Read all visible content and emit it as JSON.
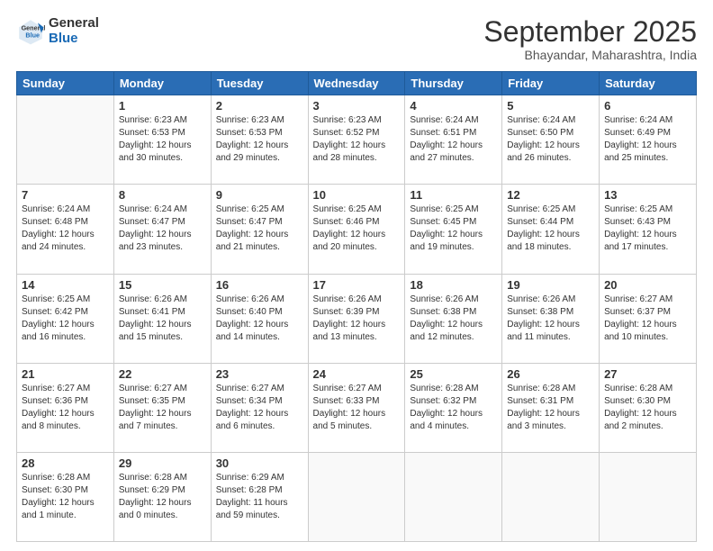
{
  "header": {
    "logo": {
      "general": "General",
      "blue": "Blue"
    },
    "title": "September 2025",
    "subtitle": "Bhayandar, Maharashtra, India"
  },
  "weekdays": [
    "Sunday",
    "Monday",
    "Tuesday",
    "Wednesday",
    "Thursday",
    "Friday",
    "Saturday"
  ],
  "weeks": [
    [
      {
        "day": "",
        "info": ""
      },
      {
        "day": "1",
        "info": "Sunrise: 6:23 AM\nSunset: 6:53 PM\nDaylight: 12 hours\nand 30 minutes."
      },
      {
        "day": "2",
        "info": "Sunrise: 6:23 AM\nSunset: 6:53 PM\nDaylight: 12 hours\nand 29 minutes."
      },
      {
        "day": "3",
        "info": "Sunrise: 6:23 AM\nSunset: 6:52 PM\nDaylight: 12 hours\nand 28 minutes."
      },
      {
        "day": "4",
        "info": "Sunrise: 6:24 AM\nSunset: 6:51 PM\nDaylight: 12 hours\nand 27 minutes."
      },
      {
        "day": "5",
        "info": "Sunrise: 6:24 AM\nSunset: 6:50 PM\nDaylight: 12 hours\nand 26 minutes."
      },
      {
        "day": "6",
        "info": "Sunrise: 6:24 AM\nSunset: 6:49 PM\nDaylight: 12 hours\nand 25 minutes."
      }
    ],
    [
      {
        "day": "7",
        "info": "Sunrise: 6:24 AM\nSunset: 6:48 PM\nDaylight: 12 hours\nand 24 minutes."
      },
      {
        "day": "8",
        "info": "Sunrise: 6:24 AM\nSunset: 6:47 PM\nDaylight: 12 hours\nand 23 minutes."
      },
      {
        "day": "9",
        "info": "Sunrise: 6:25 AM\nSunset: 6:47 PM\nDaylight: 12 hours\nand 21 minutes."
      },
      {
        "day": "10",
        "info": "Sunrise: 6:25 AM\nSunset: 6:46 PM\nDaylight: 12 hours\nand 20 minutes."
      },
      {
        "day": "11",
        "info": "Sunrise: 6:25 AM\nSunset: 6:45 PM\nDaylight: 12 hours\nand 19 minutes."
      },
      {
        "day": "12",
        "info": "Sunrise: 6:25 AM\nSunset: 6:44 PM\nDaylight: 12 hours\nand 18 minutes."
      },
      {
        "day": "13",
        "info": "Sunrise: 6:25 AM\nSunset: 6:43 PM\nDaylight: 12 hours\nand 17 minutes."
      }
    ],
    [
      {
        "day": "14",
        "info": "Sunrise: 6:25 AM\nSunset: 6:42 PM\nDaylight: 12 hours\nand 16 minutes."
      },
      {
        "day": "15",
        "info": "Sunrise: 6:26 AM\nSunset: 6:41 PM\nDaylight: 12 hours\nand 15 minutes."
      },
      {
        "day": "16",
        "info": "Sunrise: 6:26 AM\nSunset: 6:40 PM\nDaylight: 12 hours\nand 14 minutes."
      },
      {
        "day": "17",
        "info": "Sunrise: 6:26 AM\nSunset: 6:39 PM\nDaylight: 12 hours\nand 13 minutes."
      },
      {
        "day": "18",
        "info": "Sunrise: 6:26 AM\nSunset: 6:38 PM\nDaylight: 12 hours\nand 12 minutes."
      },
      {
        "day": "19",
        "info": "Sunrise: 6:26 AM\nSunset: 6:38 PM\nDaylight: 12 hours\nand 11 minutes."
      },
      {
        "day": "20",
        "info": "Sunrise: 6:27 AM\nSunset: 6:37 PM\nDaylight: 12 hours\nand 10 minutes."
      }
    ],
    [
      {
        "day": "21",
        "info": "Sunrise: 6:27 AM\nSunset: 6:36 PM\nDaylight: 12 hours\nand 8 minutes."
      },
      {
        "day": "22",
        "info": "Sunrise: 6:27 AM\nSunset: 6:35 PM\nDaylight: 12 hours\nand 7 minutes."
      },
      {
        "day": "23",
        "info": "Sunrise: 6:27 AM\nSunset: 6:34 PM\nDaylight: 12 hours\nand 6 minutes."
      },
      {
        "day": "24",
        "info": "Sunrise: 6:27 AM\nSunset: 6:33 PM\nDaylight: 12 hours\nand 5 minutes."
      },
      {
        "day": "25",
        "info": "Sunrise: 6:28 AM\nSunset: 6:32 PM\nDaylight: 12 hours\nand 4 minutes."
      },
      {
        "day": "26",
        "info": "Sunrise: 6:28 AM\nSunset: 6:31 PM\nDaylight: 12 hours\nand 3 minutes."
      },
      {
        "day": "27",
        "info": "Sunrise: 6:28 AM\nSunset: 6:30 PM\nDaylight: 12 hours\nand 2 minutes."
      }
    ],
    [
      {
        "day": "28",
        "info": "Sunrise: 6:28 AM\nSunset: 6:30 PM\nDaylight: 12 hours\nand 1 minute."
      },
      {
        "day": "29",
        "info": "Sunrise: 6:28 AM\nSunset: 6:29 PM\nDaylight: 12 hours\nand 0 minutes."
      },
      {
        "day": "30",
        "info": "Sunrise: 6:29 AM\nSunset: 6:28 PM\nDaylight: 11 hours\nand 59 minutes."
      },
      {
        "day": "",
        "info": ""
      },
      {
        "day": "",
        "info": ""
      },
      {
        "day": "",
        "info": ""
      },
      {
        "day": "",
        "info": ""
      }
    ]
  ]
}
